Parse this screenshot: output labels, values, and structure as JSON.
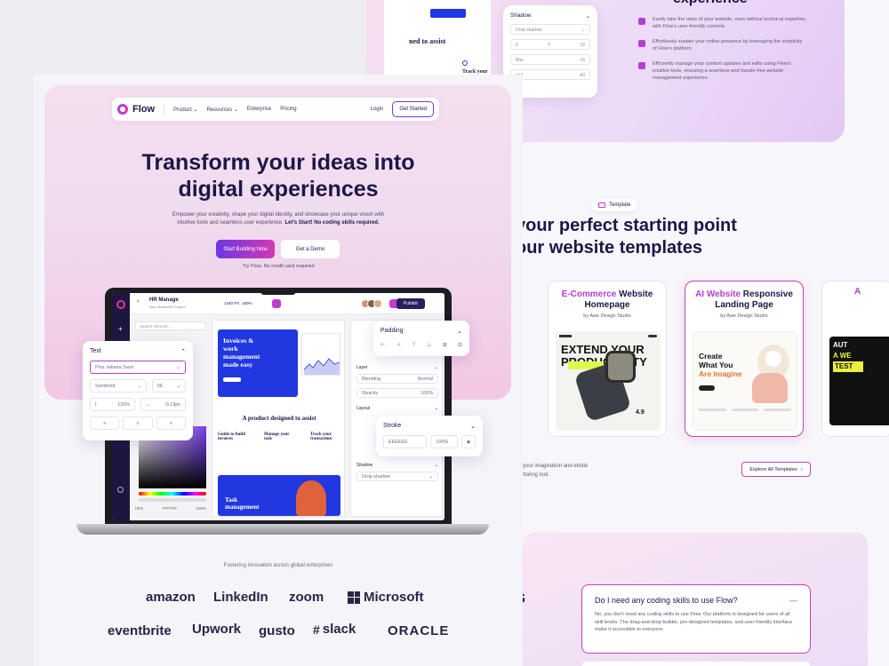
{
  "back": {
    "heading_cut": "experience",
    "features": [
      "Easily take the reins of your website, even without technical expertise, with Flow's user-friendly controls.",
      "Effortlessly sustain your online presence by leveraging the simplicity of Flow's platform.",
      "Efficiently manage your content updates and edits using Flow's intuitive tools, ensuring a seamless and hassle-free website management experience."
    ],
    "shadow_panel": {
      "title": "Shadow",
      "style": "Drop shadow",
      "x": "6",
      "y": "Y",
      "y_val": "15",
      "blur_label": "Blur",
      "blur_val": "16",
      "spread_label": "ead",
      "spread_val": "-40"
    },
    "doc_peek": {
      "headline": "ned to assist",
      "card_label": "Track your"
    },
    "badge": "Template",
    "templates_title_1": "your perfect starting point",
    "templates_title_2": "our website templates",
    "templates": [
      {
        "accent": "E-Commerce",
        "rest": " Website Homepage",
        "by": "by Awe Design Studio",
        "shot_title": "EXTEND YOUR PRODUCTIVITY",
        "rating": "4.9"
      },
      {
        "accent": "AI Website",
        "rest": " Responsive Landing Page",
        "by": "by Awe Design Studio",
        "shot_title_1": "Create",
        "shot_title_2": "What You",
        "shot_title_3": "Are Imagine"
      },
      {
        "peek_1": "AUT",
        "peek_2": "A WE",
        "peek_3": "TEST",
        "peek_4": "A"
      }
    ],
    "templates_copy": "sh your imagination and ebsite authoring tool.",
    "explore_label": "Explore All Templates",
    "faq_cut": "s",
    "faq": {
      "question": "Do I need any coding skills to use Flow?",
      "answer": "No, you don't need any coding skills to use Flow. Our platform is designed for users of all skill levels. The drag-and-drop builder, pre-designed templates, and user-friendly interface make it accessible to everyone."
    }
  },
  "front": {
    "nav": {
      "logo": "Flow",
      "items": [
        "Product",
        "Resources",
        "Enterprise",
        "Pricing"
      ],
      "login": "Login",
      "cta": "Get Started"
    },
    "headline_1": "Transform your ideas into",
    "headline_2": "digital experiences",
    "lead": "Empower your creativity, shape your digital identity, and showcase your unique vision with intuitive tools and seamless user experience.",
    "lead_bold": "Let's Start! No coding skills required.",
    "cta_primary": "Start Building Now",
    "cta_secondary": "Get a Demo",
    "trial": "Try Flow. No credit card required",
    "editor": {
      "project": "HR Manage",
      "subproject": "Awe Studio/HR Project",
      "viewport": "1440 PX",
      "zoom": "100%",
      "publish": "Publish",
      "search": "Search element...",
      "card_headline": "Invoices & work management made easy",
      "section_title": "A product designed to assist",
      "col1": "Guide to build invoices",
      "col2": "Manage your task",
      "col3": "Track your transaction",
      "card2": "Task management",
      "blending": "Blending",
      "blending_val": "Normal",
      "opacity": "Opacity",
      "opacity_val": "100%",
      "layer": "Layer",
      "layout": "Layout",
      "shadow": "Shadow",
      "drop_shadow": "Drop shadow",
      "hex": "HEX",
      "hex_val": "FFFFFF",
      "hex_pct": "100%"
    },
    "text_panel": {
      "title": "Text",
      "font": "Plus Jakarta Sans",
      "weight": "Semibold",
      "size": "56",
      "line_height": "120%",
      "letter": "-0.13px"
    },
    "padding_panel": {
      "title": "Padding"
    },
    "stroke_panel": {
      "title": "Stroke",
      "hex": "EEEEEE",
      "pct": "100%"
    },
    "fostering": "Fostering innovation across global enterprises",
    "brands": [
      "amazon",
      "LinkedIn",
      "zoom",
      "Microsoft",
      "eventbrite",
      "Upwork",
      "gusto",
      "slack",
      "ORACLE"
    ]
  },
  "colors": {
    "accent": "#b13fd2",
    "brand_dark": "#1d1747",
    "blue": "#2137e0",
    "pink": "#d23bb0"
  }
}
